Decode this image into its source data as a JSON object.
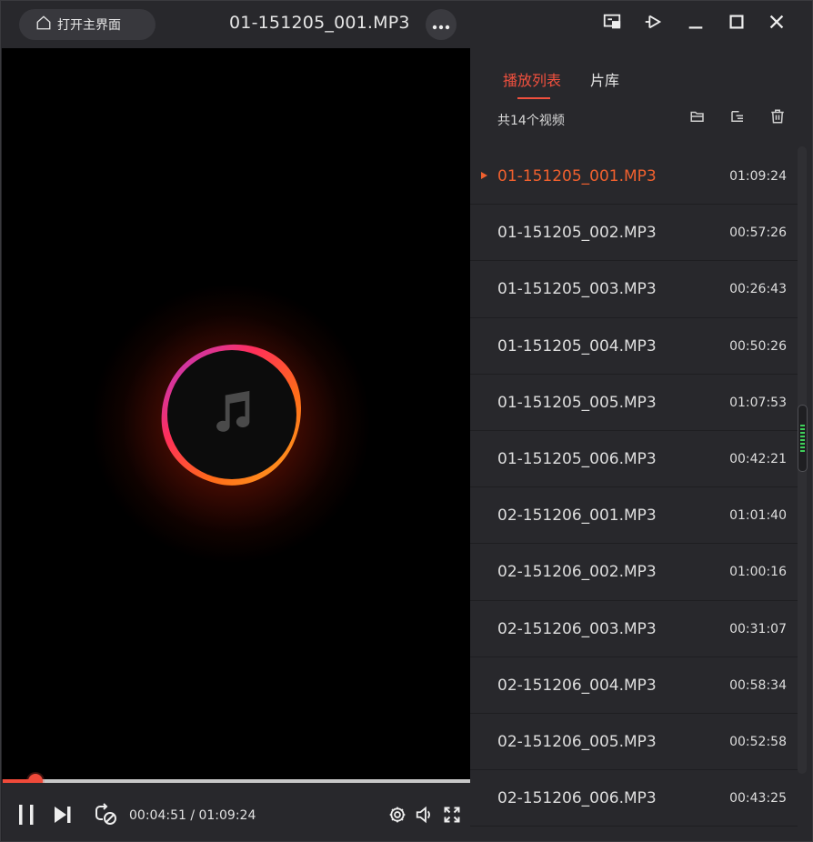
{
  "titlebar": {
    "home_label": "打开主界面",
    "title": "01-151205_001.MP3",
    "more_label": "···"
  },
  "player": {
    "time_display": "00:04:51 / 01:09:24",
    "progress_fraction": 0.07
  },
  "playlist": {
    "tabs": [
      "播放列表",
      "片库"
    ],
    "active_tab": 0,
    "count_label": "共14个视频",
    "items": [
      {
        "name": "01-151205_001.MP3",
        "duration": "01:09:24"
      },
      {
        "name": "01-151205_002.MP3",
        "duration": "00:57:26"
      },
      {
        "name": "01-151205_003.MP3",
        "duration": "00:26:43"
      },
      {
        "name": "01-151205_004.MP3",
        "duration": "00:50:26"
      },
      {
        "name": "01-151205_005.MP3",
        "duration": "01:07:53"
      },
      {
        "name": "01-151205_006.MP3",
        "duration": "00:42:21"
      },
      {
        "name": "02-151206_001.MP3",
        "duration": "01:01:40"
      },
      {
        "name": "02-151206_002.MP3",
        "duration": "01:00:16"
      },
      {
        "name": "02-151206_003.MP3",
        "duration": "00:31:07"
      },
      {
        "name": "02-151206_004.MP3",
        "duration": "00:58:34"
      },
      {
        "name": "02-151206_005.MP3",
        "duration": "00:52:58"
      },
      {
        "name": "02-151206_006.MP3",
        "duration": "00:43:25"
      }
    ],
    "active_index": 0
  },
  "colors": {
    "accent": "#f0503e",
    "active_item": "#f0602e",
    "panel_bg": "#28282c",
    "video_bg": "#000000"
  },
  "icons": {
    "home": "home-icon",
    "more": "more-icon",
    "screen_cast": "screen-cast-icon",
    "pin": "pin-icon",
    "minimize": "minimize-icon",
    "maximize": "maximize-icon",
    "close": "close-icon",
    "music": "music-note-icon",
    "pause": "pause-icon",
    "next": "next-icon",
    "loop": "loop-icon",
    "settings": "settings-icon",
    "volume": "volume-icon",
    "fullscreen": "fullscreen-icon",
    "open_folder": "open-folder-icon",
    "sort": "sort-icon",
    "delete": "delete-icon"
  }
}
